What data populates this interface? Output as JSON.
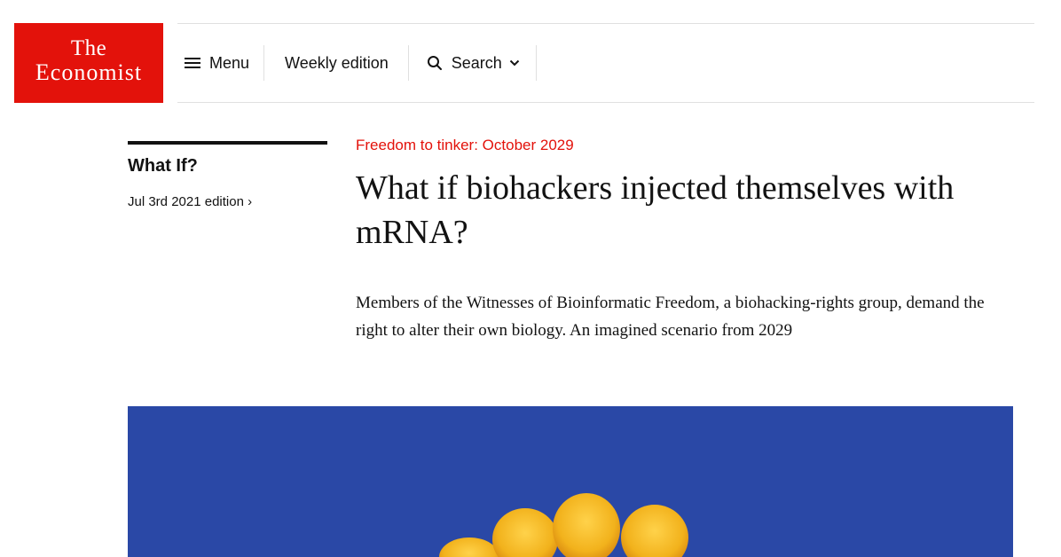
{
  "brand": {
    "line1": "The",
    "line2": "Economist",
    "color": "#e3120b"
  },
  "nav": {
    "menu_label": "Menu",
    "weekly_label": "Weekly edition",
    "search_label": "Search"
  },
  "sidebar": {
    "section_title": "What If?",
    "edition_link": "Jul 3rd 2021 edition ›"
  },
  "article": {
    "kicker": "Freedom to tinker: October 2029",
    "headline": "What if biohackers injected themselves with mRNA?",
    "standfirst": "Members of the Witnesses of Bioinformatic Freedom, a biohacking-rights group, demand the right to alter their own biology. An imagined scenario from 2029"
  },
  "hero": {
    "background": "#2a48a6",
    "fingers_color": "#f2b21c"
  }
}
